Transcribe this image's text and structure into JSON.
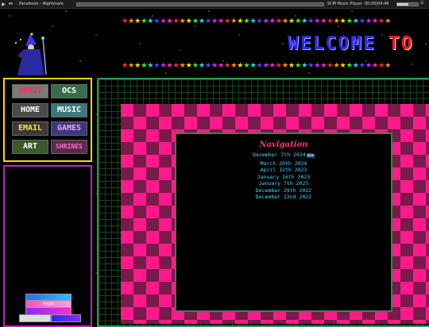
{
  "player": {
    "track_title": "Paradoxia - Nightmare",
    "player_name": "SCM Music Player",
    "time_display": "00:00|04:46",
    "progress": 0,
    "volume": 0.55,
    "icons": [
      "play-icon",
      "next-icon",
      "menu-icon"
    ]
  },
  "header": {
    "welcome_word1": "WELCOME",
    "welcome_word2": "TO",
    "star_colors": [
      "#ff2a2a",
      "#ff9a00",
      "#ffe100",
      "#2aff2a",
      "#2ad8ff",
      "#4a4aff",
      "#d02aff",
      "#ff2ad0"
    ]
  },
  "nav": {
    "about": "ABOUT",
    "ocs": "OCS",
    "home": "HOME",
    "music": "MUSIC",
    "email": "EMAIL",
    "games": "GAMES",
    "art": "ART",
    "shrines": "SHRINES"
  },
  "badges": {
    "angel": "Angel",
    "bottom_left": "",
    "bottom_right": ""
  },
  "content": {
    "heading": "Navigation",
    "new_badge": "NEW",
    "entries": [
      "December 7th 2024",
      "March 20th 2024",
      "April 12th 2023",
      "January 16th 2023",
      "January 7th 2023",
      "December 29th 2022",
      "December 22nd 2022"
    ]
  },
  "colors": {
    "nav_border": "#ffd400",
    "left_panel_border": "#c020c0",
    "main_border": "#20a050",
    "checker_pink": "#ff1a8c",
    "checker_dark": "#7a1a4a",
    "link_color": "#40d8ff",
    "heading_color": "#ff3070"
  }
}
